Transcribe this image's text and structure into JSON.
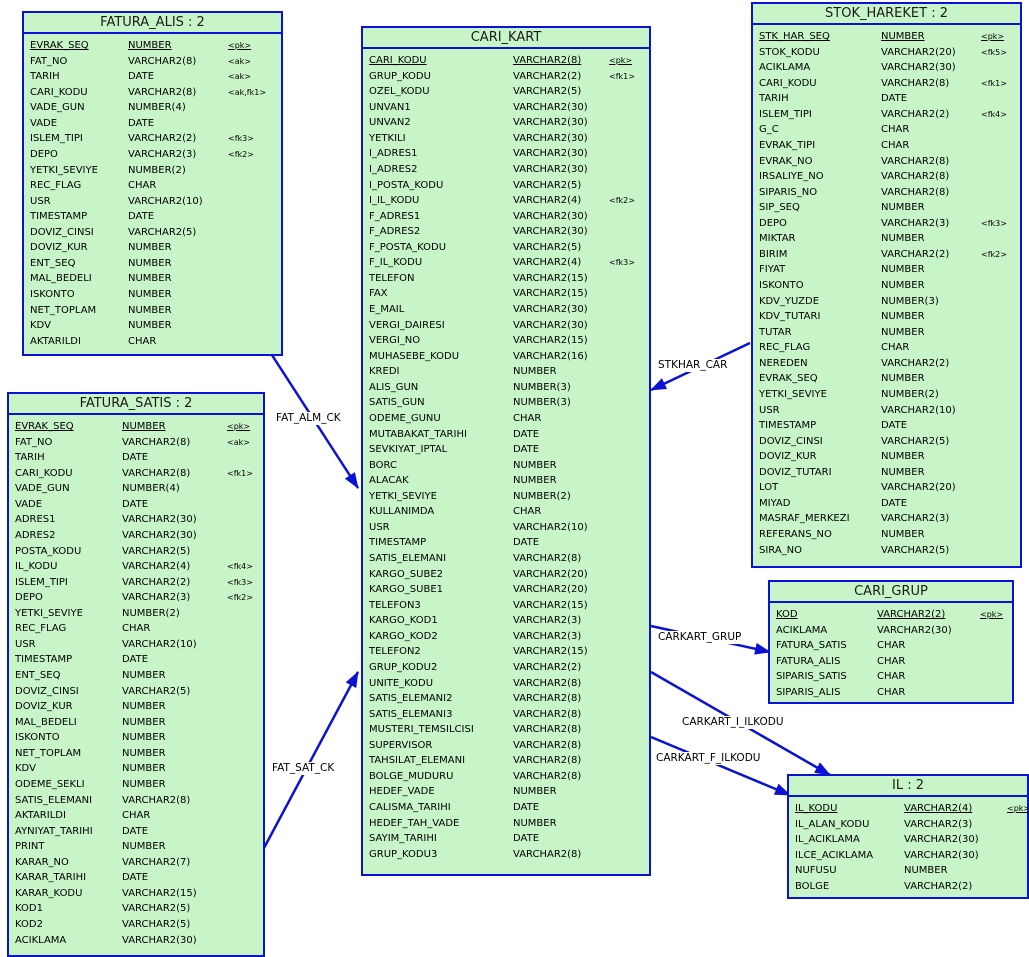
{
  "colors": {
    "entity_fill": "#c8f5c8",
    "line": "#0b12d4"
  },
  "entities": [
    {
      "id": "fatura_alis",
      "title": "FATURA_ALIS : 2",
      "cols": [
        [
          "EVRAK_SEQ",
          "NUMBER",
          "<pk>"
        ],
        [
          "FAT_NO",
          "VARCHAR2(8)",
          "<ak>"
        ],
        [
          "TARIH",
          "DATE",
          "<ak>"
        ],
        [
          "CARI_KODU",
          "VARCHAR2(8)",
          "<ak,fk1>"
        ],
        [
          "VADE_GUN",
          "NUMBER(4)",
          ""
        ],
        [
          "VADE",
          "DATE",
          ""
        ],
        [
          "ISLEM_TIPI",
          "VARCHAR2(2)",
          "<fk3>"
        ],
        [
          "DEPO",
          "VARCHAR2(3)",
          "<fk2>"
        ],
        [
          "YETKI_SEVIYE",
          "NUMBER(2)",
          ""
        ],
        [
          "REC_FLAG",
          "CHAR",
          ""
        ],
        [
          "USR",
          "VARCHAR2(10)",
          ""
        ],
        [
          "TIMESTAMP",
          "DATE",
          ""
        ],
        [
          "DOVIZ_CINSI",
          "VARCHAR2(5)",
          ""
        ],
        [
          "DOVIZ_KUR",
          "NUMBER",
          ""
        ],
        [
          "ENT_SEQ",
          "NUMBER",
          ""
        ],
        [
          "MAL_BEDELI",
          "NUMBER",
          ""
        ],
        [
          "ISKONTO",
          "NUMBER",
          ""
        ],
        [
          "NET_TOPLAM",
          "NUMBER",
          ""
        ],
        [
          "KDV",
          "NUMBER",
          ""
        ],
        [
          "AKTARILDI",
          "CHAR",
          ""
        ]
      ]
    },
    {
      "id": "fatura_satis",
      "title": "FATURA_SATIS : 2",
      "cols": [
        [
          "EVRAK_SEQ",
          "NUMBER",
          "<pk>"
        ],
        [
          "FAT_NO",
          "VARCHAR2(8)",
          "<ak>"
        ],
        [
          "TARIH",
          "DATE",
          ""
        ],
        [
          "CARI_KODU",
          "VARCHAR2(8)",
          "<fk1>"
        ],
        [
          "VADE_GUN",
          "NUMBER(4)",
          ""
        ],
        [
          "VADE",
          "DATE",
          ""
        ],
        [
          "ADRES1",
          "VARCHAR2(30)",
          ""
        ],
        [
          "ADRES2",
          "VARCHAR2(30)",
          ""
        ],
        [
          "POSTA_KODU",
          "VARCHAR2(5)",
          ""
        ],
        [
          "IL_KODU",
          "VARCHAR2(4)",
          "<fk4>"
        ],
        [
          "ISLEM_TIPI",
          "VARCHAR2(2)",
          "<fk3>"
        ],
        [
          "DEPO",
          "VARCHAR2(3)",
          "<fk2>"
        ],
        [
          "YETKI_SEVIYE",
          "NUMBER(2)",
          ""
        ],
        [
          "REC_FLAG",
          "CHAR",
          ""
        ],
        [
          "USR",
          "VARCHAR2(10)",
          ""
        ],
        [
          "TIMESTAMP",
          "DATE",
          ""
        ],
        [
          "ENT_SEQ",
          "NUMBER",
          ""
        ],
        [
          "DOVIZ_CINSI",
          "VARCHAR2(5)",
          ""
        ],
        [
          "DOVIZ_KUR",
          "NUMBER",
          ""
        ],
        [
          "MAL_BEDELI",
          "NUMBER",
          ""
        ],
        [
          "ISKONTO",
          "NUMBER",
          ""
        ],
        [
          "NET_TOPLAM",
          "NUMBER",
          ""
        ],
        [
          "KDV",
          "NUMBER",
          ""
        ],
        [
          "ODEME_SEKLI",
          "NUMBER",
          ""
        ],
        [
          "SATIS_ELEMANI",
          "VARCHAR2(8)",
          ""
        ],
        [
          "AKTARILDI",
          "CHAR",
          ""
        ],
        [
          "AYNIYAT_TARIHI",
          "DATE",
          ""
        ],
        [
          "PRINT",
          "NUMBER",
          ""
        ],
        [
          "KARAR_NO",
          "VARCHAR2(7)",
          ""
        ],
        [
          "KARAR_TARIHI",
          "DATE",
          ""
        ],
        [
          "KARAR_KODU",
          "VARCHAR2(15)",
          ""
        ],
        [
          "KOD1",
          "VARCHAR2(5)",
          ""
        ],
        [
          "KOD2",
          "VARCHAR2(5)",
          ""
        ],
        [
          "ACIKLAMA",
          "VARCHAR2(30)",
          ""
        ]
      ]
    },
    {
      "id": "cari_kart",
      "title": "CARI_KART",
      "cols": [
        [
          "CARI_KODU",
          "VARCHAR2(8)",
          "<pk>"
        ],
        [
          "GRUP_KODU",
          "VARCHAR2(2)",
          "<fk1>"
        ],
        [
          "OZEL_KODU",
          "VARCHAR2(5)",
          ""
        ],
        [
          "UNVAN1",
          "VARCHAR2(30)",
          ""
        ],
        [
          "UNVAN2",
          "VARCHAR2(30)",
          ""
        ],
        [
          "YETKILI",
          "VARCHAR2(30)",
          ""
        ],
        [
          "I_ADRES1",
          "VARCHAR2(30)",
          ""
        ],
        [
          "I_ADRES2",
          "VARCHAR2(30)",
          ""
        ],
        [
          "I_POSTA_KODU",
          "VARCHAR2(5)",
          ""
        ],
        [
          "I_IL_KODU",
          "VARCHAR2(4)",
          "<fk2>"
        ],
        [
          "F_ADRES1",
          "VARCHAR2(30)",
          ""
        ],
        [
          "F_ADRES2",
          "VARCHAR2(30)",
          ""
        ],
        [
          "F_POSTA_KODU",
          "VARCHAR2(5)",
          ""
        ],
        [
          "F_IL_KODU",
          "VARCHAR2(4)",
          "<fk3>"
        ],
        [
          "TELEFON",
          "VARCHAR2(15)",
          ""
        ],
        [
          "FAX",
          "VARCHAR2(15)",
          ""
        ],
        [
          "E_MAIL",
          "VARCHAR2(30)",
          ""
        ],
        [
          "VERGI_DAIRESI",
          "VARCHAR2(30)",
          ""
        ],
        [
          "VERGI_NO",
          "VARCHAR2(15)",
          ""
        ],
        [
          "MUHASEBE_KODU",
          "VARCHAR2(16)",
          ""
        ],
        [
          "KREDI",
          "NUMBER",
          ""
        ],
        [
          "ALIS_GUN",
          "NUMBER(3)",
          ""
        ],
        [
          "SATIS_GUN",
          "NUMBER(3)",
          ""
        ],
        [
          "ODEME_GUNU",
          "CHAR",
          ""
        ],
        [
          "MUTABAKAT_TARIHI",
          "DATE",
          ""
        ],
        [
          "SEVKIYAT_IPTAL",
          "DATE",
          ""
        ],
        [
          "BORC",
          "NUMBER",
          ""
        ],
        [
          "ALACAK",
          "NUMBER",
          ""
        ],
        [
          "YETKI_SEVIYE",
          "NUMBER(2)",
          ""
        ],
        [
          "KULLANIMDA",
          "CHAR",
          ""
        ],
        [
          "USR",
          "VARCHAR2(10)",
          ""
        ],
        [
          "TIMESTAMP",
          "DATE",
          ""
        ],
        [
          "SATIS_ELEMANI",
          "VARCHAR2(8)",
          ""
        ],
        [
          "KARGO_SUBE2",
          "VARCHAR2(20)",
          ""
        ],
        [
          "KARGO_SUBE1",
          "VARCHAR2(20)",
          ""
        ],
        [
          "TELEFON3",
          "VARCHAR2(15)",
          ""
        ],
        [
          "KARGO_KOD1",
          "VARCHAR2(3)",
          ""
        ],
        [
          "KARGO_KOD2",
          "VARCHAR2(3)",
          ""
        ],
        [
          "TELEFON2",
          "VARCHAR2(15)",
          ""
        ],
        [
          "GRUP_KODU2",
          "VARCHAR2(2)",
          ""
        ],
        [
          "UNITE_KODU",
          "VARCHAR2(8)",
          ""
        ],
        [
          "SATIS_ELEMANI2",
          "VARCHAR2(8)",
          ""
        ],
        [
          "SATIS_ELEMANI3",
          "VARCHAR2(8)",
          ""
        ],
        [
          "MUSTERI_TEMSILCISI",
          "VARCHAR2(8)",
          ""
        ],
        [
          "SUPERVISOR",
          "VARCHAR2(8)",
          ""
        ],
        [
          "TAHSILAT_ELEMANI",
          "VARCHAR2(8)",
          ""
        ],
        [
          "BOLGE_MUDURU",
          "VARCHAR2(8)",
          ""
        ],
        [
          "HEDEF_VADE",
          "NUMBER",
          ""
        ],
        [
          "CALISMA_TARIHI",
          "DATE",
          ""
        ],
        [
          "HEDEF_TAH_VADE",
          "NUMBER",
          ""
        ],
        [
          "SAYIM_TARIHI",
          "DATE",
          ""
        ],
        [
          "GRUP_KODU3",
          "VARCHAR2(8)",
          ""
        ]
      ]
    },
    {
      "id": "stok_hareket",
      "title": "STOK_HAREKET : 2",
      "cols": [
        [
          "STK_HAR_SEQ",
          "NUMBER",
          "<pk>"
        ],
        [
          "STOK_KODU",
          "VARCHAR2(20)",
          "<fk5>"
        ],
        [
          "ACIKLAMA",
          "VARCHAR2(30)",
          ""
        ],
        [
          "CARI_KODU",
          "VARCHAR2(8)",
          "<fk1>"
        ],
        [
          "TARIH",
          "DATE",
          ""
        ],
        [
          "ISLEM_TIPI",
          "VARCHAR2(2)",
          "<fk4>"
        ],
        [
          "G_C",
          "CHAR",
          ""
        ],
        [
          "EVRAK_TIPI",
          "CHAR",
          ""
        ],
        [
          "EVRAK_NO",
          "VARCHAR2(8)",
          ""
        ],
        [
          "IRSALIYE_NO",
          "VARCHAR2(8)",
          ""
        ],
        [
          "SIPARIS_NO",
          "VARCHAR2(8)",
          ""
        ],
        [
          "SIP_SEQ",
          "NUMBER",
          ""
        ],
        [
          "DEPO",
          "VARCHAR2(3)",
          "<fk3>"
        ],
        [
          "MIKTAR",
          "NUMBER",
          ""
        ],
        [
          "BIRIM",
          "VARCHAR2(2)",
          "<fk2>"
        ],
        [
          "FIYAT",
          "NUMBER",
          ""
        ],
        [
          "ISKONTO",
          "NUMBER",
          ""
        ],
        [
          "KDV_YUZDE",
          "NUMBER(3)",
          ""
        ],
        [
          "KDV_TUTARI",
          "NUMBER",
          ""
        ],
        [
          "TUTAR",
          "NUMBER",
          ""
        ],
        [
          "REC_FLAG",
          "CHAR",
          ""
        ],
        [
          "NEREDEN",
          "VARCHAR2(2)",
          ""
        ],
        [
          "EVRAK_SEQ",
          "NUMBER",
          ""
        ],
        [
          "YETKI_SEVIYE",
          "NUMBER(2)",
          ""
        ],
        [
          "USR",
          "VARCHAR2(10)",
          ""
        ],
        [
          "TIMESTAMP",
          "DATE",
          ""
        ],
        [
          "DOVIZ_CINSI",
          "VARCHAR2(5)",
          ""
        ],
        [
          "DOVIZ_KUR",
          "NUMBER",
          ""
        ],
        [
          "DOVIZ_TUTARI",
          "NUMBER",
          ""
        ],
        [
          "LOT",
          "VARCHAR2(20)",
          ""
        ],
        [
          "MIYAD",
          "DATE",
          ""
        ],
        [
          "MASRAF_MERKEZI",
          "VARCHAR2(3)",
          ""
        ],
        [
          "REFERANS_NO",
          "NUMBER",
          ""
        ],
        [
          "SIRA_NO",
          "VARCHAR2(5)",
          ""
        ]
      ]
    },
    {
      "id": "cari_grup",
      "title": "CARI_GRUP",
      "cols": [
        [
          "KOD",
          "VARCHAR2(2)",
          "<pk>"
        ],
        [
          "ACIKLAMA",
          "VARCHAR2(30)",
          ""
        ],
        [
          "FATURA_SATIS",
          "CHAR",
          ""
        ],
        [
          "FATURA_ALIS",
          "CHAR",
          ""
        ],
        [
          "SIPARIS_SATIS",
          "CHAR",
          ""
        ],
        [
          "SIPARIS_ALIS",
          "CHAR",
          ""
        ]
      ]
    },
    {
      "id": "il",
      "title": "IL : 2",
      "cols": [
        [
          "IL_KODU",
          "VARCHAR2(4)",
          "<pk>"
        ],
        [
          "IL_ALAN_KODU",
          "VARCHAR2(3)",
          ""
        ],
        [
          "IL_ACIKLAMA",
          "VARCHAR2(30)",
          ""
        ],
        [
          "ILCE_ACIKLAMA",
          "VARCHAR2(30)",
          ""
        ],
        [
          "NUFUSU",
          "NUMBER",
          ""
        ],
        [
          "BOLGE",
          "VARCHAR2(2)",
          ""
        ]
      ]
    }
  ],
  "relations": [
    {
      "id": "fat_alm_ck",
      "label": "FAT_ALM_CK"
    },
    {
      "id": "fat_sat_ck",
      "label": "FAT_SAT_CK"
    },
    {
      "id": "stkhar_car",
      "label": "STKHAR_CAR"
    },
    {
      "id": "carkart_grup",
      "label": "CARKART_GRUP"
    },
    {
      "id": "carkart_i_ilkodu",
      "label": "CARKART_I_ILKODU"
    },
    {
      "id": "carkart_f_ilkodu",
      "label": "CARKART_F_ILKODU"
    }
  ]
}
